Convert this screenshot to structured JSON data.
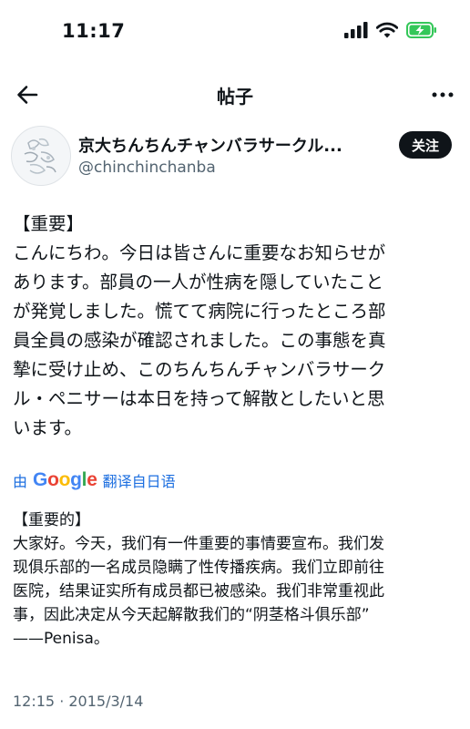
{
  "status_bar": {
    "time": "11:17",
    "signal_icon": "cellular-signal-icon",
    "wifi_icon": "wifi-icon",
    "battery_icon": "battery-charging-icon",
    "battery_color": "#34c759"
  },
  "header": {
    "back_icon": "arrow-left-icon",
    "title": "帖子",
    "more_icon": "more-horizontal-icon"
  },
  "author": {
    "display_name": "京大ちんちんチャンバラサークル...",
    "handle": "@chinchinchanba",
    "follow_label": "关注"
  },
  "post": {
    "lines": [
      "【重要】",
      "こんにちわ。今日は皆さんに重要なお知らせが",
      "あります。部員の一人が性病を隠していたこと",
      "が発覚しました。慌てて病院に行ったところ部",
      "員全員の感染が確認されました。この事態を真",
      "摯に受け止め、このちんちんチャンバラサーク",
      "ル・ペニサーは本日を持って解散としたいと思",
      "います。"
    ]
  },
  "translation": {
    "prefix": "由",
    "brand": "Google",
    "suffix": "翻译自日语",
    "lines": [
      "【重要的】",
      "大家好。今天，我们有一件重要的事情要宣布。我们发",
      "现俱乐部的一名成员隐瞒了性传播疾病。我们立即前往",
      "医院，结果证实所有成员都已被感染。我们非常重视此",
      "事，因此决定从今天起解散我们的“阴茎格斗俱乐部”",
      "——Penisa。"
    ]
  },
  "timestamp": "12:15 · 2015/3/14",
  "colors": {
    "text": "#0f1419",
    "secondary": "#536471",
    "link": "#1d6fe0",
    "follow_bg": "#0f1419"
  }
}
